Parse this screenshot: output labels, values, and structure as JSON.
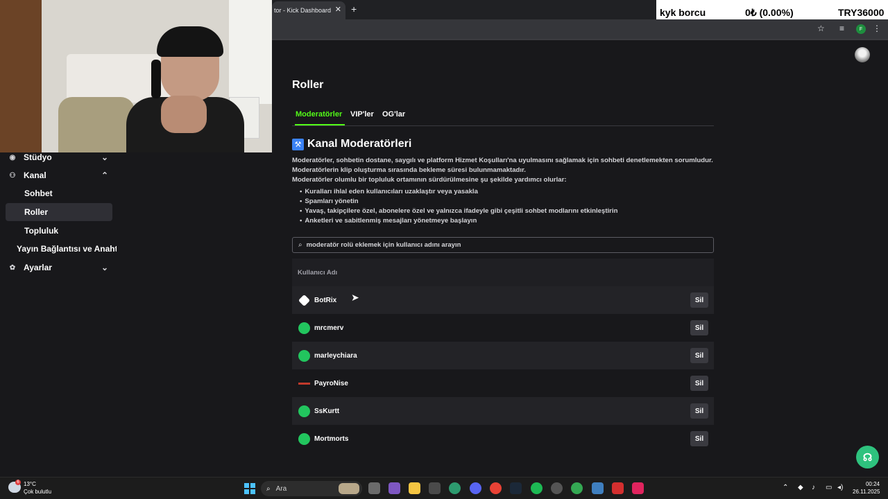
{
  "browser": {
    "tab_title": "tor - Kick Dashboard",
    "tab_close": "✕",
    "new_tab": "+",
    "profile_letter": "F"
  },
  "ticker": {
    "label": "kyk borcu",
    "change": "0₺ (0.00%)",
    "value": "TRY36000"
  },
  "sidebar": {
    "items": [
      {
        "label": "Stüdyo",
        "icon": "studio-icon"
      },
      {
        "label": "Kanal",
        "icon": "channel-icon"
      },
      {
        "label": "Sohbet"
      },
      {
        "label": "Roller",
        "active": true
      },
      {
        "label": "Topluluk"
      },
      {
        "label": "Yayın Bağlantısı ve Anahtarı"
      },
      {
        "label": "Ayarlar",
        "icon": "gear-icon"
      }
    ]
  },
  "page": {
    "title": "Roller",
    "tabs": [
      "Moderatörler",
      "VIP'ler",
      "OG'lar"
    ],
    "active_tab": "Moderatörler",
    "section_title": "Kanal Moderatörleri",
    "desc_lines": [
      "Moderatörler, sohbetin dostane, saygılı ve platform Hizmet Koşulları'na uyulmasını sağlamak için sohbeti denetlemekten sorumludur.",
      "Moderatörlerin klip oluşturma sırasında bekleme süresi bulunmamaktadır.",
      "Moderatörler olumlu bir topluluk ortamının sürdürülmesine şu şekilde yardımcı olurlar:"
    ],
    "bullets": [
      "Kuralları ihlal eden kullanıcıları uzaklaştır veya yasakla",
      "Spamları yönetin",
      "Yavaş, takipçilere özel, abonelere özel ve yalnızca ifadeyle gibi çeşitli sohbet modlarını etkinleştirin",
      "Anketleri ve sabitlenmiş mesajları yönetmeye başlayın"
    ],
    "search": {
      "placeholder": "moderatör rolü eklemek için kullanıcı adını arayın",
      "value": ""
    },
    "table": {
      "header": "Kullanıcı Adı",
      "remove_label": "Sil",
      "rows": [
        {
          "username": "BotRix",
          "avatar": "botrix-avatar"
        },
        {
          "username": "mrcmerv",
          "avatar": "default-avatar"
        },
        {
          "username": "marleychiara",
          "avatar": "default-avatar"
        },
        {
          "username": "PayroNise",
          "avatar": "payronise-avatar"
        },
        {
          "username": "SsKurtt",
          "avatar": "default-avatar"
        },
        {
          "username": "Mortmorts",
          "avatar": "default-avatar"
        }
      ]
    }
  },
  "taskbar": {
    "weather_badge": "6",
    "weather_temp": "13°C",
    "weather_desc": "Çok bulutlu",
    "search_text": "Ara",
    "time": "00:24",
    "date": "26.11.2025"
  },
  "colors": {
    "accent": "#53fc18",
    "background": "#18181b",
    "button": "#3a3a40"
  }
}
